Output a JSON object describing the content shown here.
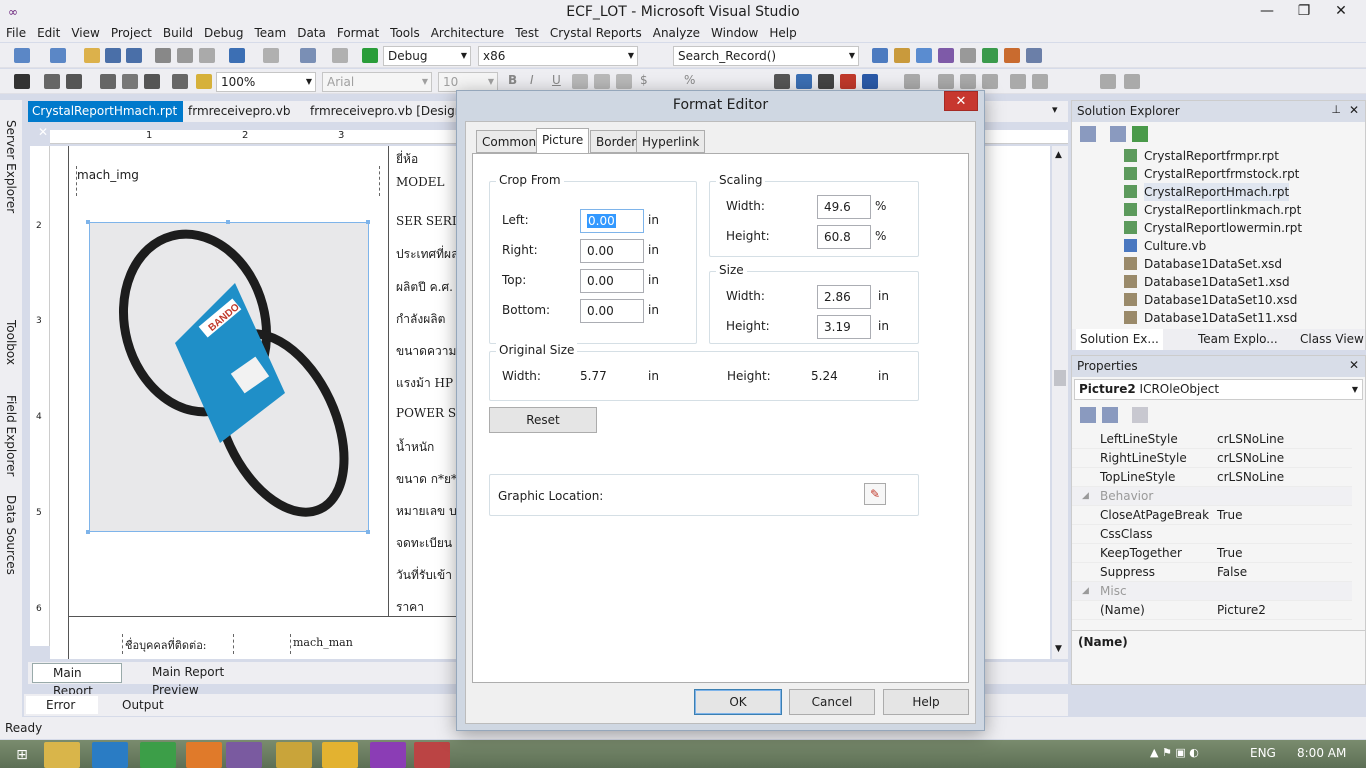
{
  "window": {
    "title": "ECF_LOT - Microsoft Visual Studio",
    "minimize": "—",
    "restore": "❐",
    "close": "✕"
  },
  "menu": [
    "File",
    "Edit",
    "View",
    "Project",
    "Build",
    "Debug",
    "Team",
    "Data",
    "Format",
    "Tools",
    "Architecture",
    "Test",
    "Crystal Reports",
    "Analyze",
    "Window",
    "Help"
  ],
  "toolbar": {
    "config": "Debug",
    "platform": "x86",
    "find": "Search_Record()",
    "zoom": "100%",
    "font": "Arial",
    "font_size": "10",
    "bold": "B",
    "italic": "I",
    "underline": "U",
    "currency": "$",
    "percent": "%"
  },
  "side_tabs": [
    "Server Explorer",
    "Toolbox",
    "Field Explorer",
    "Data Sources"
  ],
  "doc_tabs": [
    {
      "label": "CrystalReportHmach.rpt",
      "active": true
    },
    {
      "label": "frmreceivepro.vb",
      "active": false
    },
    {
      "label": "frmreceivepro.vb [Design]",
      "active": false
    }
  ],
  "ruler": {
    "h": [
      "1",
      "2",
      "3"
    ],
    "v": [
      "2",
      "3",
      "4",
      "5",
      "6"
    ]
  },
  "report": {
    "image_field": "mach_img",
    "labels": [
      "ยี่ห้อ",
      "MODEL",
      "SER SERIA",
      "ประเทศที่ผล",
      "ผลิตปี ค.ศ.",
      "กำลังผลิต",
      "ขนาดความ",
      "แรงม้า HP",
      "POWER SU",
      "น้ำหนัก",
      "ขนาด ก*ย*",
      "หมายเลข บ",
      "จดทะเบียน",
      "วันที่รับเข้า",
      "ราคา"
    ],
    "footer_label": "ชื่อบุคคลที่ติดต่อ:",
    "footer_field": "mach_man",
    "belt_text": "BANDO"
  },
  "bottom_tabs": [
    "Main Report",
    "Main Report Preview"
  ],
  "panels": [
    "Error List",
    "Output"
  ],
  "status": "Ready",
  "solution_explorer": {
    "title": "Solution Explorer",
    "items": [
      "CrystalReportfrmpr.rpt",
      "CrystalReportfrmstock.rpt",
      "CrystalReportHmach.rpt",
      "CrystalReportlinkmach.rpt",
      "CrystalReportlowermin.rpt",
      "Culture.vb",
      "Database1DataSet.xsd",
      "Database1DataSet1.xsd",
      "Database1DataSet10.xsd",
      "Database1DataSet11.xsd"
    ],
    "tabs": [
      "Solution Ex...",
      "Team Explo...",
      "Class View"
    ]
  },
  "properties": {
    "title": "Properties",
    "object": "Picture2",
    "object_type": "ICROleObject",
    "rows": [
      {
        "name": "LeftLineStyle",
        "value": "crLSNoLine"
      },
      {
        "name": "RightLineStyle",
        "value": "crLSNoLine"
      },
      {
        "name": "TopLineStyle",
        "value": "crLSNoLine"
      },
      {
        "name": "Behavior",
        "value": "",
        "cat": true
      },
      {
        "name": "CloseAtPageBreak",
        "value": "True"
      },
      {
        "name": "CssClass",
        "value": ""
      },
      {
        "name": "KeepTogether",
        "value": "True"
      },
      {
        "name": "Suppress",
        "value": "False"
      },
      {
        "name": "Misc",
        "value": "",
        "cat": true
      },
      {
        "name": "(Name)",
        "value": "Picture2"
      }
    ],
    "desc": "(Name)"
  },
  "dialog": {
    "title": "Format Editor",
    "close": "✕",
    "tabs": [
      "Common",
      "Picture",
      "Border",
      "Hyperlink"
    ],
    "crop": {
      "title": "Crop From",
      "left_label": "Left:",
      "left": "0.00",
      "right_label": "Right:",
      "right": "0.00",
      "top_label": "Top:",
      "top": "0.00",
      "bottom_label": "Bottom:",
      "bottom": "0.00",
      "unit": "in"
    },
    "scaling": {
      "title": "Scaling",
      "width_label": "Width:",
      "width": "49.6",
      "height_label": "Height:",
      "height": "60.8",
      "unit": "%"
    },
    "size": {
      "title": "Size",
      "width_label": "Width:",
      "width": "2.86",
      "height_label": "Height:",
      "height": "3.19",
      "unit": "in"
    },
    "original": {
      "title": "Original Size",
      "width_label": "Width:",
      "width": "5.77",
      "height_label": "Height:",
      "height": "5.24",
      "unit": "in"
    },
    "reset": "Reset",
    "graphic_location": "Graphic Location:",
    "ok": "OK",
    "cancel": "Cancel",
    "help": "Help"
  },
  "taskbar": {
    "lang": "ENG",
    "time": "8:00 AM"
  }
}
